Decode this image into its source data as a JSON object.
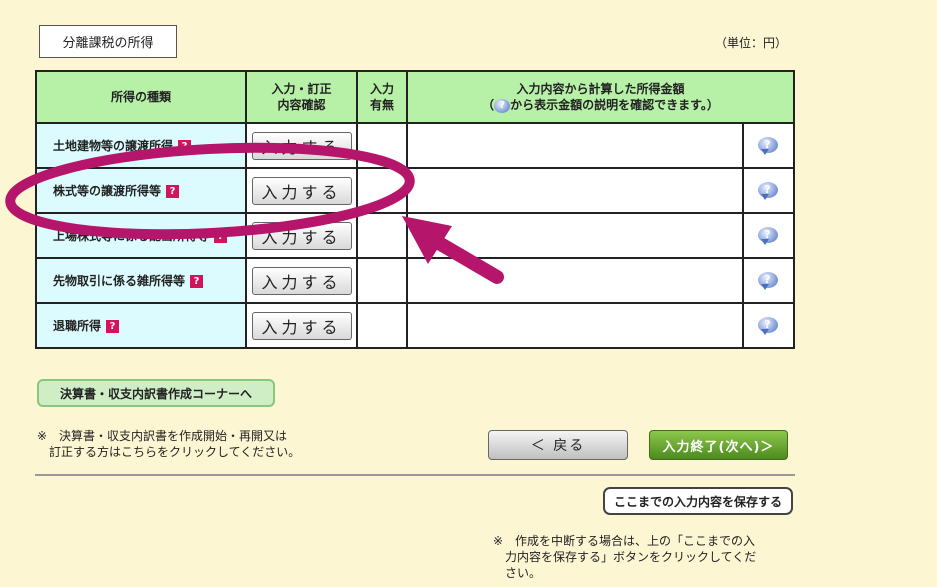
{
  "section_title": "分離課税の所得",
  "unit": "（単位：円）",
  "table": {
    "headers": {
      "kind": "所得の種類",
      "input_line1": "入力・訂正",
      "input_line2": "内容確認",
      "presence_line1": "入力",
      "presence_line2": "有無",
      "amount_line1": "入力内容から計算した所得金額",
      "amount_line2_prefix": "（",
      "amount_line2_icon": "?",
      "amount_line2_suffix": "から表示金額の説明を確認できます。）"
    },
    "rows": [
      {
        "label": "土地建物等の譲渡所得"
      },
      {
        "label": "株式等の譲渡所得等"
      },
      {
        "label": "上場株式等に係る配当所得等"
      },
      {
        "label": "先物取引に係る雑所得等"
      },
      {
        "label": "退職所得"
      }
    ],
    "input_button_label": "入力する",
    "help_mark": "?",
    "info_mark": "?"
  },
  "corner_button": "決算書・収支内訳書作成コーナーへ",
  "note1_line1": "※　決算書・収支内訳書を作成開始・再開又は",
  "note1_line2": "　訂正する方はこちらをクリックしてください。",
  "back_button": "＜ 戻る",
  "next_button": "入力終了(次へ)＞",
  "save_button": "ここまでの入力内容を保存する",
  "note2_line1": "※　作成を中断する場合は、上の「ここまでの入",
  "note2_line2": "　力内容を保存する」ボタンをクリックしてくだ",
  "note2_line3": "　さい。",
  "colors": {
    "background": "#fdf6d2",
    "header_bg": "#b7f0a7",
    "kind_bg": "#dcfbff",
    "annotation": "#b5166b",
    "next_button": "#5e9a28"
  }
}
